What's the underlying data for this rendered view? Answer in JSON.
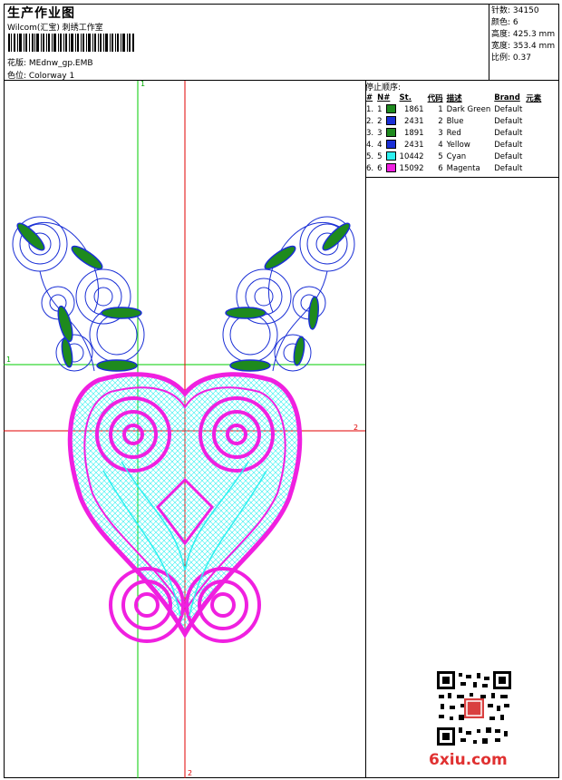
{
  "header": {
    "title": "生产作业图",
    "subtitle": "Wilcom(汇宝) 刺绣工作室",
    "design_label": "花版: MEdnw_gp.EMB",
    "colorway_label": "色位: Colorway 1"
  },
  "stats": [
    {
      "label": "针数",
      "value": "34150"
    },
    {
      "label": "颜色",
      "value": "6"
    },
    {
      "label": "高度",
      "value": "425.3 mm"
    },
    {
      "label": "宽度",
      "value": "353.4 mm"
    },
    {
      "label": "比例",
      "value": "0.37"
    }
  ],
  "sequence": {
    "title": "停止顺序:",
    "headers": [
      "#",
      "N#",
      "St.",
      "代码",
      "描述",
      "Brand",
      "元素"
    ],
    "rows": [
      {
        "n": "1.",
        "nn": "1",
        "color": "#1e8a1e",
        "st": "1861",
        "code": "1",
        "desc": "Dark Green",
        "brand": "Default"
      },
      {
        "n": "2.",
        "nn": "2",
        "color": "#1a2fd6",
        "st": "2431",
        "code": "2",
        "desc": "Blue",
        "brand": "Default"
      },
      {
        "n": "3.",
        "nn": "3",
        "color": "#1e8a1e",
        "st": "1891",
        "code": "3",
        "desc": "Red",
        "brand": "Default"
      },
      {
        "n": "4.",
        "nn": "4",
        "color": "#1a2fd6",
        "st": "2431",
        "code": "4",
        "desc": "Yellow",
        "brand": "Default"
      },
      {
        "n": "5.",
        "nn": "5",
        "color": "#2ef0f0",
        "st": "10442",
        "code": "5",
        "desc": "Cyan",
        "brand": "Default"
      },
      {
        "n": "6.",
        "nn": "6",
        "color": "#f020e0",
        "st": "15092",
        "code": "6",
        "desc": "Magenta",
        "brand": "Default"
      }
    ]
  },
  "guides": {
    "v1": "1",
    "h1": "1",
    "h2": "2",
    "v2": "2"
  },
  "watermark": "6xiu.com",
  "colors": {
    "magenta": "#f020e0",
    "cyan": "#2ef0f0",
    "blue": "#1a2fd6",
    "green": "#1e8a1e",
    "guide_green": "#00cc00",
    "guide_red": "#e00000"
  }
}
